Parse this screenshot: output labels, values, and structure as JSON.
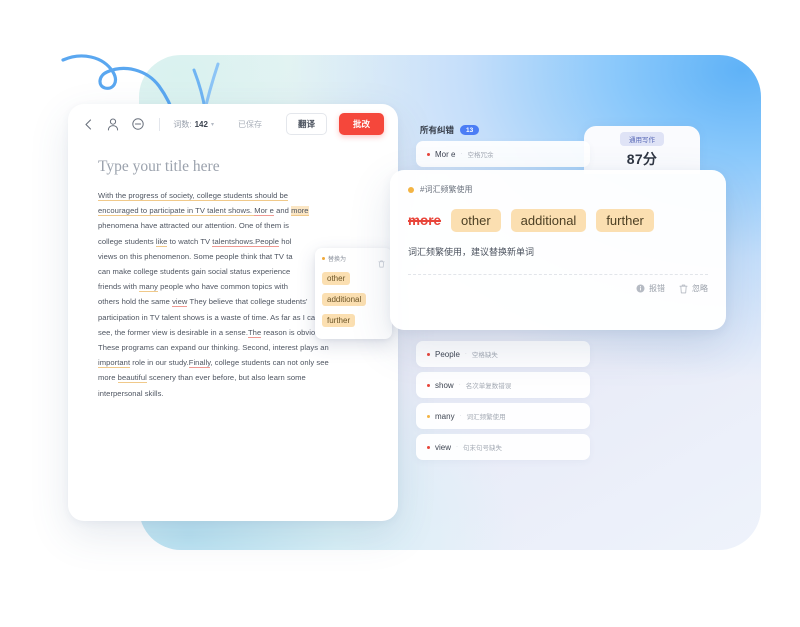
{
  "editor": {
    "toolbar": {
      "back_icon": "chevron-left-icon",
      "person_icon": "person-icon",
      "minus_circle_icon": "minus-circle-icon",
      "wordcount_label": "词数:",
      "wordcount_value": "142",
      "caret": "▾",
      "saved_label": "已保存",
      "translate_label": "翻译",
      "correct_label": "批改"
    },
    "title": "Type your title here",
    "paragraph": {
      "l1a": "With the progress of society, college students should be",
      "l2a": "encouraged to participate in TV talent shows. ",
      "l2b": "Mor e",
      "l2c": " and ",
      "l2d": "more",
      "l3a": "phenomena have attracted our attention. One of them is ",
      "l4a": "college students ",
      "l4b": "like",
      "l4c": " to watch TV ",
      "l4d": "talentshows.People",
      "l4e": " hol",
      "l5a": "views on this phenomenon. Some people think that TV ta",
      "l6a": "can make college students gain social status experience",
      "l7a": "friends with ",
      "l7b": "many",
      "l7c": " people who have common topics with",
      "l8a": "others hold the same ",
      "l8b": "view",
      "l8c": " They believe that college students'",
      "l9a": "participation in TV talent shows is a waste of time. As far as I can",
      "l10a": "see, the former view is desirable in a sense.",
      "l10b": "The",
      "l10c": " reason is obvious.",
      "l11a": "These programs can expand our thinking. Second, interest plays an",
      "l12a": "important",
      "l12b": " role in our study.",
      "l12c": "Finally",
      "l12d": ", college students can not only see",
      "l13a": "more ",
      "l13b": "beautiful",
      "l13c": " scenery than ever before, but also learn some",
      "l14a": "interpersonal skills."
    },
    "suggest_popup": {
      "title": "替换为",
      "delete_icon": "trash-icon",
      "options": [
        "other",
        "additional",
        "further"
      ]
    }
  },
  "panel": {
    "header_title": "所有纠错",
    "header_badge": "13",
    "score": {
      "tag": "通用写作",
      "value": "87分"
    },
    "rows": [
      {
        "word": "Mor e",
        "sep": "·",
        "kind": "空格冗余",
        "dot_color": "#e8453a"
      },
      {
        "word": "People",
        "sep": "·",
        "kind": "空格缺失",
        "dot_color": "#e8453a"
      },
      {
        "word": "show",
        "sep": "·",
        "kind": "名次单复数错误",
        "dot_color": "#e8453a"
      },
      {
        "word": "many",
        "sep": "·",
        "kind": "词汇频繁使用",
        "dot_color": "#f3b444"
      },
      {
        "word": "view",
        "sep": "·",
        "kind": "句末句号缺失",
        "dot_color": "#e8453a"
      }
    ],
    "detail": {
      "tag": "#词汇频繁使用",
      "original": "more",
      "suggestions": [
        "other",
        "additional",
        "further"
      ],
      "explanation": "词汇频繁使用，建议替换新单词",
      "report_icon": "info-icon",
      "report_label": "报错",
      "ignore_icon": "trash-icon",
      "ignore_label": "忽略"
    }
  },
  "decor": {
    "squiggle_icon": "squiggle-doodle-icon",
    "accent_blue": "#4b7df5",
    "accent_red": "#f5473b",
    "accent_orange": "#f3b444"
  }
}
